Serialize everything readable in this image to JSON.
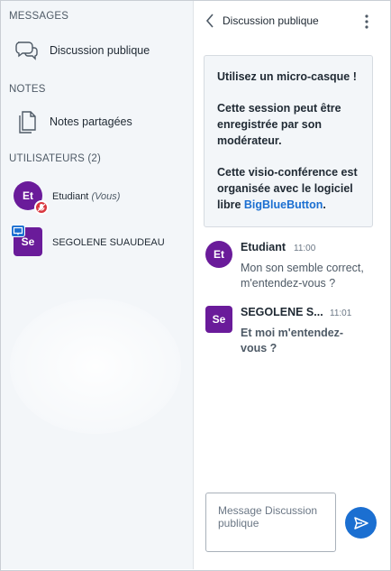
{
  "sidebar": {
    "messages_title": "MESSAGES",
    "public_chat_label": "Discussion publique",
    "notes_title": "NOTES",
    "shared_notes_label": "Notes partagées",
    "users_title": "UTILISATEURS (2)",
    "users": [
      {
        "initials": "Et",
        "name": "Etudiant",
        "suffix": "(Vous)",
        "avatar_color": "#6a1b9a",
        "status": "microphone-muted"
      },
      {
        "initials": "Se",
        "name": "SEGOLENE SUAUDEAU",
        "suffix": "",
        "avatar_color": "#6a1b9a",
        "status": "presenter"
      }
    ]
  },
  "chat": {
    "header_title": "Discussion publique",
    "welcome": {
      "line1": "Utilisez un micro-casque !",
      "line2": "Cette session peut être enregistrée par son modérateur.",
      "line3_prefix": "Cette visio-conférence est organisée avec le logiciel libre ",
      "line3_link": "BigBlueButton",
      "line3_suffix": "."
    },
    "messages": [
      {
        "initials": "Et",
        "author": "Etudiant",
        "time": "11:00",
        "text": "Mon son semble correct, m'entendez-vous ?",
        "avatar_shape": "circle"
      },
      {
        "initials": "Se",
        "author": "SEGOLENE S...",
        "time": "11:01",
        "text": "Et moi m'entendez-vous ?",
        "avatar_shape": "square"
      }
    ],
    "composer_placeholder": "Message Discussion publique"
  },
  "colors": {
    "accent": "#1b6fd1",
    "avatar": "#6a1b9a",
    "muted_badge": "#d9363e",
    "sidebar_bg": "#f3f6f9"
  },
  "icons": {
    "public_chat": "chat-bubbles-icon",
    "shared_notes": "documents-icon",
    "back": "chevron-left-icon",
    "menu": "more-vertical-icon",
    "send": "send-icon"
  }
}
